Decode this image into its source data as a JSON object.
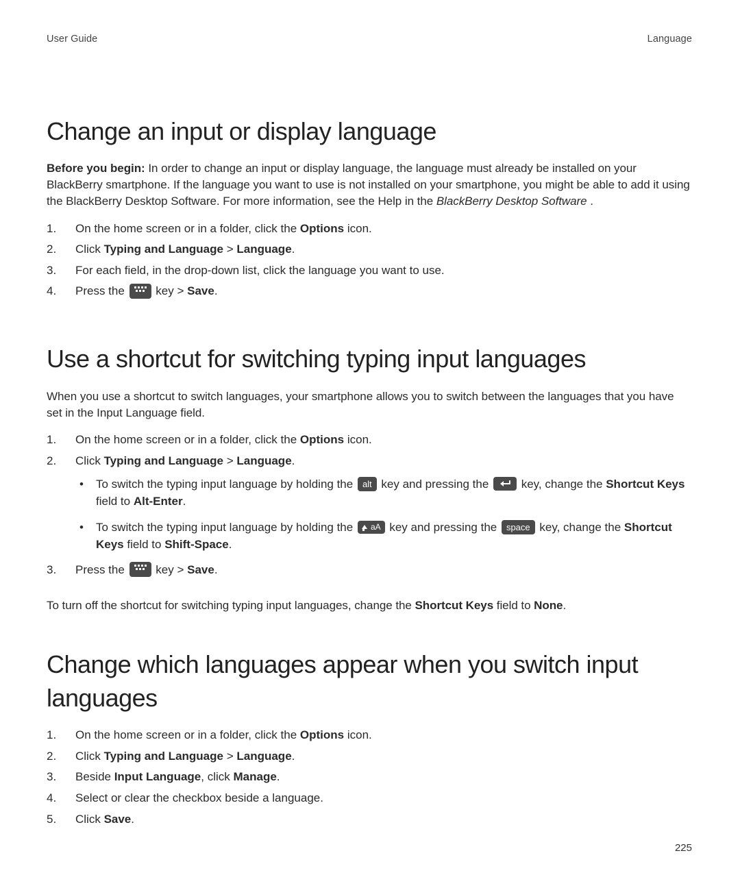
{
  "header": {
    "left": "User Guide",
    "right": "Language"
  },
  "page_number": "225",
  "section1": {
    "title": "Change an input or display language",
    "intro_lead": "Before you begin:",
    "intro_rest": " In order to change an input or display language, the language must already be installed on your BlackBerry smartphone. If the language you want to use is not installed on your smartphone, you might be able to add it using the BlackBerry Desktop Software. For more information, see the Help in the ",
    "intro_app": "BlackBerry Desktop Software",
    "intro_tail": " .",
    "step1_a": "On the home screen or in a folder, click the ",
    "step1_b": "Options",
    "step1_c": " icon.",
    "step2_a": "Click ",
    "step2_b": "Typing and Language",
    "step2_c": " > ",
    "step2_d": "Language",
    "step2_e": ".",
    "step3": "For each field, in the drop-down list, click the language you want to use.",
    "step4_a": "Press the ",
    "step4_b": " key > ",
    "step4_c": "Save",
    "step4_d": "."
  },
  "section2": {
    "title": "Use a shortcut for switching typing input languages",
    "intro": "When you use a shortcut to switch languages, your smartphone allows you to switch between the languages that you have set in the Input Language field.",
    "step1_a": "On the home screen or in a folder, click the ",
    "step1_b": "Options",
    "step1_c": " icon.",
    "step2_a": "Click ",
    "step2_b": "Typing and Language",
    "step2_c": " > ",
    "step2_d": "Language",
    "step2_e": ".",
    "bullet1_a": "To switch the typing input language by holding the ",
    "bullet1_key1": "alt",
    "bullet1_b": " key and pressing the ",
    "bullet1_c": " key, change the ",
    "bullet1_d": "Shortcut Keys",
    "bullet1_e": " field to ",
    "bullet1_f": "Alt-Enter",
    "bullet1_g": ".",
    "bullet2_a": "To switch the typing input language by holding the ",
    "bullet2_key1_label": "aA",
    "bullet2_b": " key and pressing the ",
    "bullet2_key2": "space",
    "bullet2_c": " key, change the ",
    "bullet2_d": "Shortcut Keys",
    "bullet2_e": " field to ",
    "bullet2_f": "Shift-Space",
    "bullet2_g": ".",
    "step3_a": "Press the ",
    "step3_b": " key > ",
    "step3_c": "Save",
    "step3_d": ".",
    "after_a": "To turn off the shortcut for switching typing input languages, change the ",
    "after_b": "Shortcut Keys",
    "after_c": " field to ",
    "after_d": "None",
    "after_e": "."
  },
  "section3": {
    "title": "Change which languages appear when you switch input languages",
    "step1_a": "On the home screen or in a folder, click the ",
    "step1_b": "Options",
    "step1_c": " icon.",
    "step2_a": "Click ",
    "step2_b": "Typing and Language",
    "step2_c": " > ",
    "step2_d": "Language",
    "step2_e": ".",
    "step3_a": "Beside ",
    "step3_b": "Input Language",
    "step3_c": ", click ",
    "step3_d": "Manage",
    "step3_e": ".",
    "step4": "Select or clear the checkbox beside a language.",
    "step5_a": "Click ",
    "step5_b": "Save",
    "step5_c": "."
  }
}
